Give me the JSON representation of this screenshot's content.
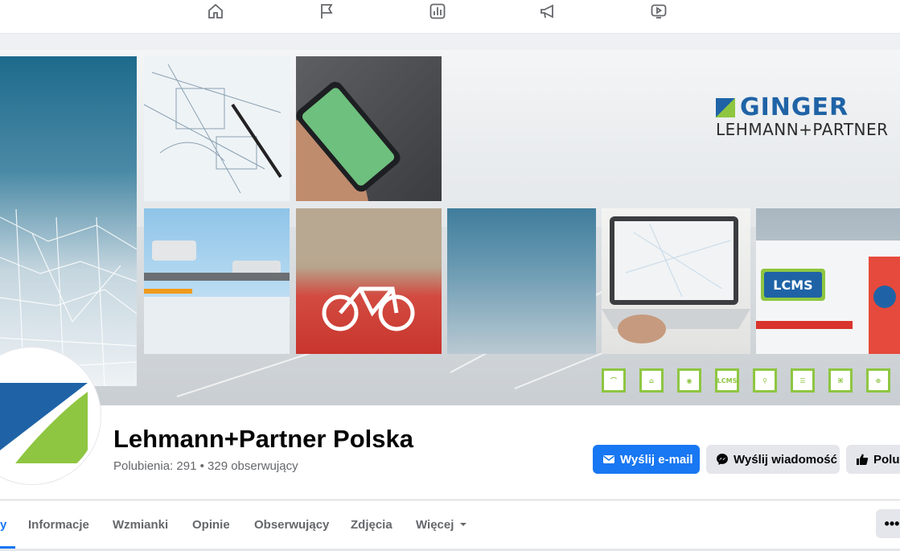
{
  "topnav": {
    "icons": [
      "home-icon",
      "flag-icon",
      "chart-icon",
      "megaphone-icon",
      "video-icon"
    ]
  },
  "cover": {
    "logo_brand": "GINGER",
    "logo_sub": "LEHMANN+PARTNER",
    "tile_labels": {
      "lcms": "LCMS"
    },
    "icon_row": [
      "LCMS"
    ]
  },
  "page": {
    "name": "Lehmann+Partner Polska",
    "stats": "Polubienia: 291 • 329 obserwujący"
  },
  "actions": {
    "email": "Wyślij e-mail",
    "message": "Wyślij wiadomość",
    "like": "Polub"
  },
  "tabs": {
    "active_fragment": "y",
    "items": [
      "Informacje",
      "Wzmianki",
      "Opinie",
      "Obserwujący",
      "Zdjęcia",
      "Więcej"
    ],
    "more_label": "•••"
  },
  "colors": {
    "accent": "#1877f2",
    "brand_blue": "#1f63a6",
    "brand_green": "#8ec641"
  }
}
